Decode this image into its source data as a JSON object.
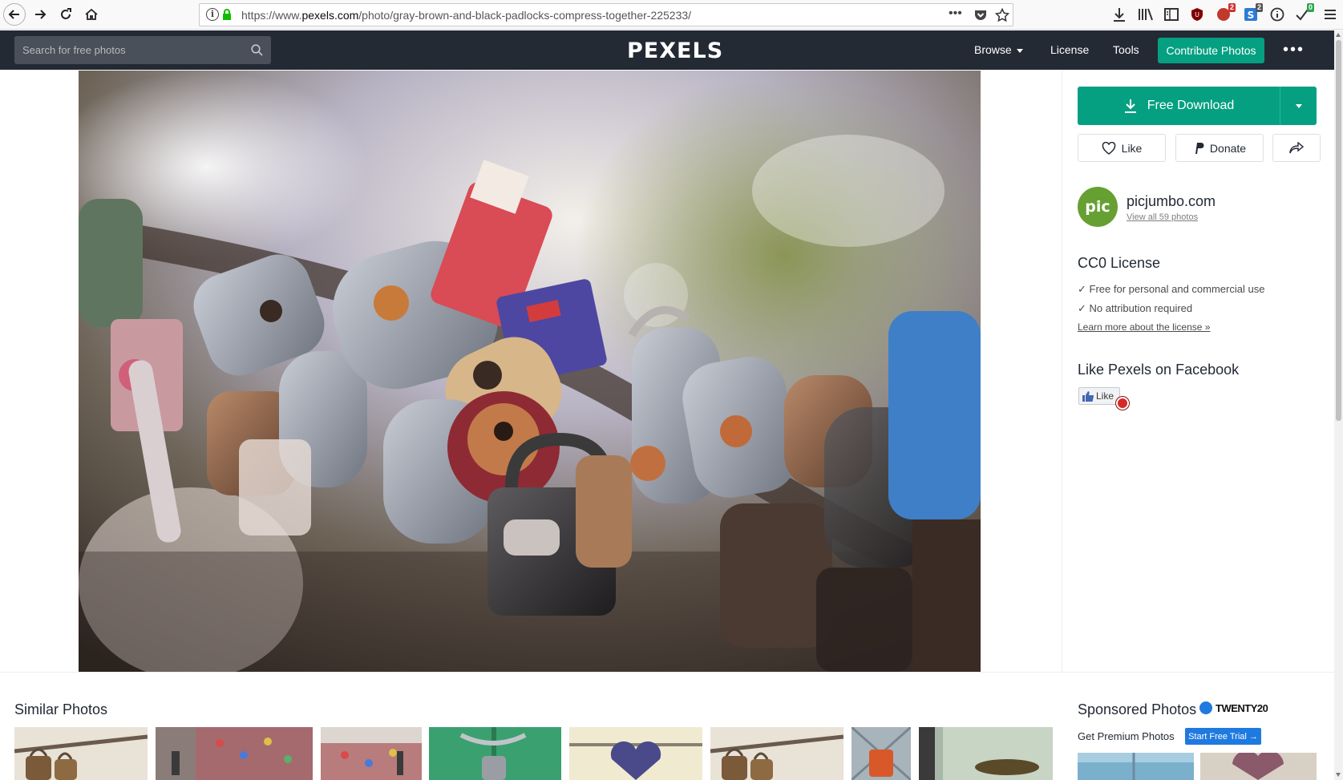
{
  "browser": {
    "url_prefix": "https://www.",
    "url_domain": "pexels.com",
    "url_path": "/photo/gray-brown-and-black-padlocks-compress-together-225233/",
    "badge_ublock": "2",
    "badge_s": "2",
    "badge_check": "0"
  },
  "header": {
    "search_placeholder": "Search for free photos",
    "logo": "PEXELS",
    "nav": {
      "browse": "Browse",
      "license": "License",
      "tools": "Tools"
    },
    "contribute": "Contribute Photos",
    "more": "•••"
  },
  "sidebar": {
    "download_label": "Free Download",
    "like_label": "Like",
    "donate_label": "Donate",
    "author": {
      "avatar_text": "pic",
      "name": "picjumbo.com",
      "view_all": "View all 59 photos"
    },
    "license": {
      "title": "CC0 License",
      "points": [
        "✓ Free for personal and commercial use",
        "✓ No attribution required"
      ],
      "learn_more": "Learn more about the license »"
    },
    "facebook": {
      "title": "Like Pexels on Facebook",
      "like": "Like"
    }
  },
  "similar": {
    "title": "Similar Photos"
  },
  "sponsored": {
    "title": "Sponsored Photos",
    "brand": "TWENTY20",
    "premium": "Get Premium Photos",
    "trial": "Start Free Trial →"
  },
  "colors": {
    "header_bg": "#232a34",
    "accent_green": "#05a081",
    "trial_blue": "#1f7ae0"
  }
}
